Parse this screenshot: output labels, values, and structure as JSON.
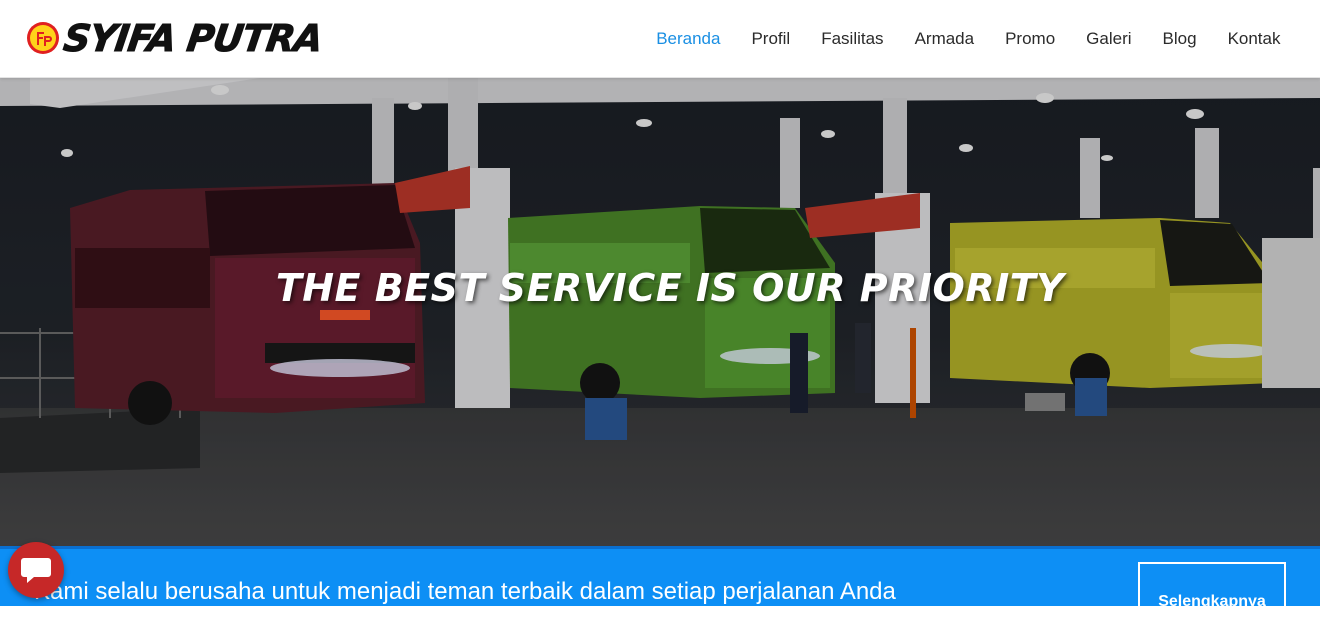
{
  "brand": {
    "name": "SYIFA PUTRA",
    "badge_letters": "SP",
    "logo_colors": {
      "ring": "#e02020",
      "fill": "#ffd21a",
      "text": "#111111"
    }
  },
  "nav": {
    "items": [
      {
        "label": "Beranda",
        "active": true
      },
      {
        "label": "Profil",
        "active": false
      },
      {
        "label": "Fasilitas",
        "active": false
      },
      {
        "label": "Armada",
        "active": false
      },
      {
        "label": "Promo",
        "active": false
      },
      {
        "label": "Galeri",
        "active": false
      },
      {
        "label": "Blog",
        "active": false
      },
      {
        "label": "Kontak",
        "active": false
      }
    ],
    "active_color": "#1a8fe3"
  },
  "hero": {
    "title": "THE BEST SERVICE IS OUR PRIORITY",
    "image_subject": "buses at a gas station at night"
  },
  "cta": {
    "text": "Kami selalu berusaha untuk menjadi teman terbaik dalam setiap perjalanan Anda",
    "button_label": "Selengkapnya",
    "background_color": "#0d8ff5"
  },
  "chat_widget": {
    "icon": "chat-bubble-icon",
    "color": "#c62828"
  }
}
